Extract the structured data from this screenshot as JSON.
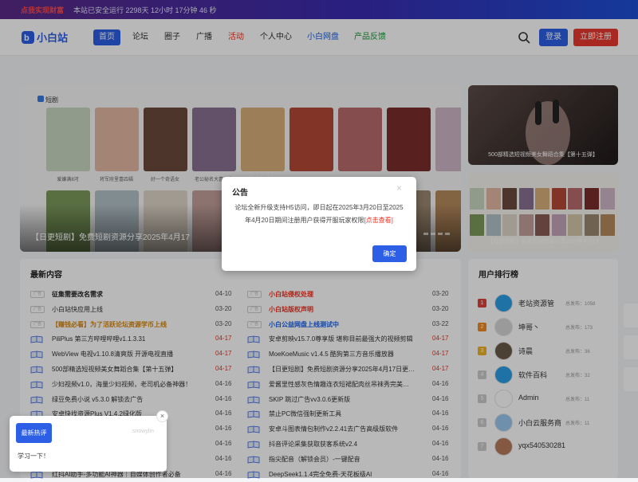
{
  "topbar": {
    "hot": "点我实现财富",
    "stat": "本站已安全运行 2298天 12小时 17分钟 46 秒"
  },
  "logo": {
    "text": "小白站"
  },
  "nav": {
    "items": [
      "首页",
      "论坛",
      "圈子",
      "广播",
      "活动",
      "个人中心",
      "小白网盘",
      "产品反馈"
    ]
  },
  "header": {
    "login": "登录",
    "register": "立即注册"
  },
  "banner": {
    "label": "短剧",
    "caption": "【日更短剧】免费短剧资源分享2025年4月17",
    "posters": [
      "爱嫌满8河",
      "将军府里喜四福",
      "好一个奇语女",
      "老公秘名大喜的我",
      "富贵仕途",
      "",
      "",
      "",
      "",
      "",
      "",
      "",
      "",
      "",
      "",
      "",
      "",
      ""
    ]
  },
  "side": {
    "top_caption": "500部精选短视频美女舞蹈合集【第十五弹】",
    "bottom_caption": "【日更短剧】免费短剧资源分享2025年4月17"
  },
  "latest": {
    "title": "最新内容",
    "left": [
      {
        "text": "征集需要改名需求",
        "date": "04-10",
        "kind": "ad",
        "style": "bold"
      },
      {
        "text": "小白站快应用上线",
        "date": "03-20",
        "kind": "ad",
        "style": "normal"
      },
      {
        "text": "【赚钱必看】为了活跃论坛资源学币上线",
        "date": "03-20",
        "kind": "ad",
        "style": "orange"
      },
      {
        "text": "PiliPlus 第三方哔哩哔哩v1.1.3.31",
        "date": "04-17",
        "kind": "book",
        "style": "normal",
        "red": true
      },
      {
        "text": "WebView 电视v1.10.8清爽版 开源电视直播",
        "date": "04-17",
        "kind": "book",
        "style": "normal",
        "red": true
      },
      {
        "text": "500部精选短视频美女舞蹈合集【第十五弹】",
        "date": "04-17",
        "kind": "book",
        "style": "normal",
        "red": true
      },
      {
        "text": "少妇视频v1.0，海量少妇视频，老司机必备神器！",
        "date": "04-16",
        "kind": "book",
        "style": "normal"
      },
      {
        "text": "绿豆免费小说 v5.3.0 解锁去广告",
        "date": "04-16",
        "kind": "book",
        "style": "normal"
      },
      {
        "text": "安卓快找资源Plus V1.4.2绿化版",
        "date": "04-16",
        "kind": "book",
        "style": "normal"
      },
      {
        "text": "…神器",
        "date": "04-16",
        "kind": "book",
        "style": "normal"
      },
      {
        "text": "…中文去广告…",
        "date": "04-16",
        "kind": "book",
        "style": "normal"
      },
      {
        "text": "…爆单必备",
        "date": "04-16",
        "kind": "book",
        "style": "normal"
      },
      {
        "text": "红抖AI助手-多功能AI神器｜自媒体创作者必备",
        "date": "04-16",
        "kind": "book",
        "style": "normal"
      }
    ],
    "right": [
      {
        "text": "小白站侵权处理",
        "date": "03-20",
        "kind": "ad",
        "style": "redbold"
      },
      {
        "text": "小白站版权声明",
        "date": "03-20",
        "kind": "ad",
        "style": "redbold"
      },
      {
        "text": "小白公益网盘上线测试中",
        "date": "03-22",
        "kind": "ad",
        "style": "blue"
      },
      {
        "text": "安卓剪映v15.7.0尊享版 堪称目前最强大的视频剪辑",
        "date": "04-17",
        "kind": "book",
        "style": "normal",
        "red": true
      },
      {
        "text": "MoeKoeMusic v1.4.5 酷狗第三方音乐播放器",
        "date": "04-17",
        "kind": "book",
        "style": "normal",
        "red": true
      },
      {
        "text": "【日更短剧】免费短剧资源分享2025年4月17日更…",
        "date": "04-17",
        "kind": "book",
        "style": "normal",
        "red": true
      },
      {
        "text": "爱酱里性感灰色情趣连衣短裙配肉丝吊袜秀完美…",
        "date": "04-16",
        "kind": "book",
        "style": "normal"
      },
      {
        "text": "SKIP 跳过广告vv3.0.6更新版",
        "date": "04-16",
        "kind": "book",
        "style": "normal"
      },
      {
        "text": "禁止PC微信强制更新工具",
        "date": "04-16",
        "kind": "book",
        "style": "normal"
      },
      {
        "text": "安卓斗图表情包制作v2.2.41去广告高级版软件",
        "date": "04-16",
        "kind": "book",
        "style": "normal"
      },
      {
        "text": "抖音评论采集获取获客系统v2.4",
        "date": "04-16",
        "kind": "book",
        "style": "normal"
      },
      {
        "text": "指尖配音（解锁会员）-一键配音",
        "date": "04-16",
        "kind": "book",
        "style": "normal"
      },
      {
        "text": "DeepSeek1.1.4完全免费-天花板级AI",
        "date": "04-16",
        "kind": "book",
        "style": "normal"
      }
    ]
  },
  "ranking": {
    "title": "用户排行榜",
    "count_prefix": "总发布：",
    "users": [
      {
        "rank": "1",
        "name": "老站资源管",
        "count": "1058",
        "color": "#e0403a",
        "avatar": "#2a9ee6"
      },
      {
        "rank": "2",
        "name": "坤哥丶",
        "count": "173",
        "color": "#f08a24",
        "avatar": "#d6d6d6"
      },
      {
        "rank": "3",
        "name": "诗晨",
        "count": "36",
        "color": "#f0b42a",
        "avatar": "#6a5a4a"
      },
      {
        "rank": "4",
        "name": "软件百科",
        "count": "32",
        "color": "#ccc",
        "avatar": "#2a9ee6"
      },
      {
        "rank": "5",
        "name": "Admin",
        "count": "11",
        "color": "#ccc",
        "avatar": "#fff"
      },
      {
        "rank": "6",
        "name": "小白云服务商",
        "count": "11",
        "color": "#ccc",
        "avatar": "#9ac8f0"
      },
      {
        "rank": "7",
        "name": "yqx540530281",
        "count": "",
        "color": "#ccc",
        "avatar": "#b87a5a"
      }
    ]
  },
  "modal": {
    "title": "公告",
    "close": "×",
    "body": "论坛全新升级支持H5访问，即日起在2025年3月20日至2025年4月20日期间注册用户获得开服玩家权限",
    "link": "[点击查看]",
    "ok": "确定"
  },
  "hotcard": {
    "tag": "最新热评",
    "watermark": "snowylin",
    "text": "学习一下！",
    "close": "×"
  }
}
